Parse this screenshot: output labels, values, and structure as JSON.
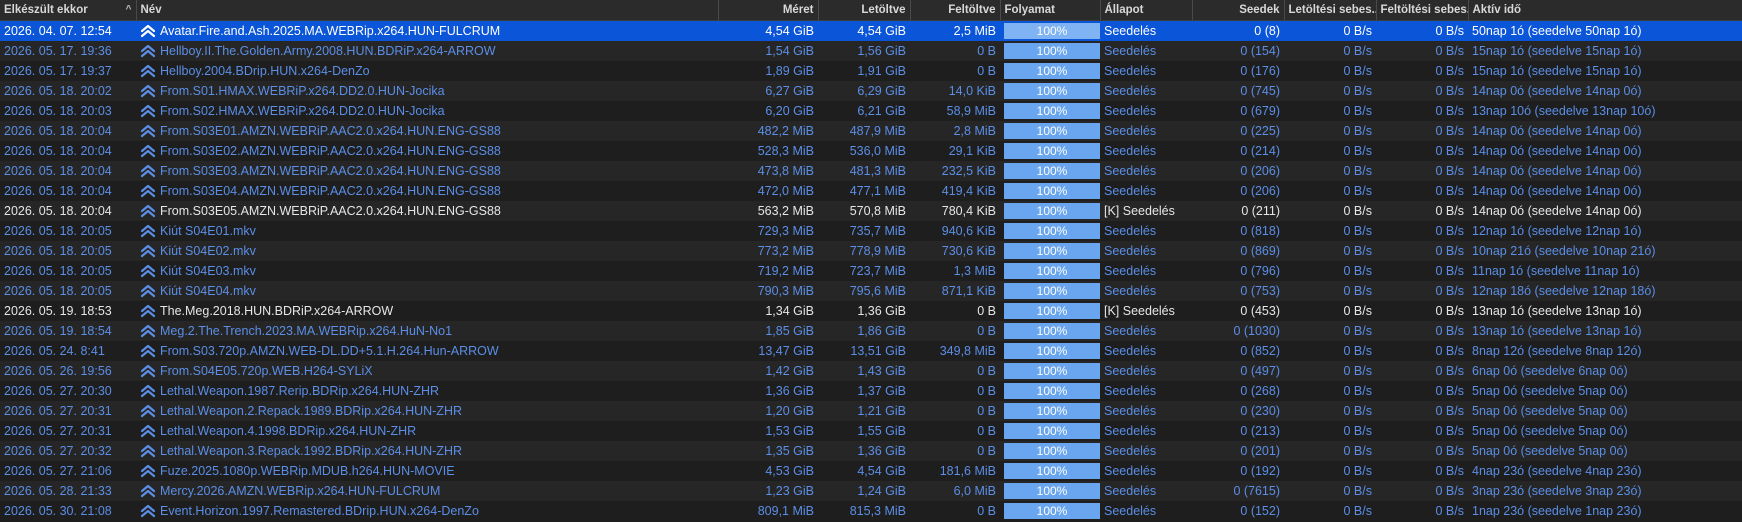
{
  "columns": {
    "completed": "Elkészült ekkor",
    "sort_indicator": "^",
    "name": "Név",
    "size": "Méret",
    "downloaded": "Letöltve",
    "uploaded": "Feltöltve",
    "progress": "Folyamat",
    "state": "Állapot",
    "seeds": "Seedek",
    "dl_speed": "Letöltési sebes...",
    "ul_speed": "Feltöltési sebes...",
    "active_time": "Aktív idő"
  },
  "colors": {
    "selection": "#0a55d8",
    "link_text": "#5b8ee6",
    "active_text": "#e6e6e6",
    "progress_fill": "#6aa6ef"
  },
  "row_icon": "double-chevron-up-icon",
  "rows": [
    {
      "completed": "2026. 04. 07. 12:54",
      "name": "Avatar.Fire.and.Ash.2025.MA.WEBRip.x264.HUN-FULCRUM",
      "size": "4,54 GiB",
      "downloaded": "4,54 GiB",
      "uploaded": "2,5 MiB",
      "progress": "100%",
      "state": "Seedelés",
      "seeds": "0 (8)",
      "dl_speed": "0 B/s",
      "ul_speed": "0 B/s",
      "active_time": "50nap 1ó (seedelve 50nap 1ó)"
    },
    {
      "completed": "2026. 05. 17. 19:36",
      "name": "Hellboy.II.The.Golden.Army.2008.HUN.BDRiP.x264-ARROW",
      "size": "1,54 GiB",
      "downloaded": "1,56 GiB",
      "uploaded": "0 B",
      "progress": "100%",
      "state": "Seedelés",
      "seeds": "0 (154)",
      "dl_speed": "0 B/s",
      "ul_speed": "0 B/s",
      "active_time": "15nap 1ó (seedelve 15nap 1ó)"
    },
    {
      "completed": "2026. 05. 17. 19:37",
      "name": "Hellboy.2004.BDrip.HUN.x264-DenZo",
      "size": "1,89 GiB",
      "downloaded": "1,91 GiB",
      "uploaded": "0 B",
      "progress": "100%",
      "state": "Seedelés",
      "seeds": "0 (176)",
      "dl_speed": "0 B/s",
      "ul_speed": "0 B/s",
      "active_time": "15nap 1ó (seedelve 15nap 1ó)"
    },
    {
      "completed": "2026. 05. 18. 20:02",
      "name": "From.S01.HMAX.WEBRiP.x264.DD2.0.HUN-Jocika",
      "size": "6,27 GiB",
      "downloaded": "6,29 GiB",
      "uploaded": "14,0 KiB",
      "progress": "100%",
      "state": "Seedelés",
      "seeds": "0 (745)",
      "dl_speed": "0 B/s",
      "ul_speed": "0 B/s",
      "active_time": "14nap 0ó (seedelve 14nap 0ó)"
    },
    {
      "completed": "2026. 05. 18. 20:03",
      "name": "From.S02.HMAX.WEBRiP.x264.DD2.0.HUN-Jocika",
      "size": "6,20 GiB",
      "downloaded": "6,21 GiB",
      "uploaded": "58,9 MiB",
      "progress": "100%",
      "state": "Seedelés",
      "seeds": "0 (679)",
      "dl_speed": "0 B/s",
      "ul_speed": "0 B/s",
      "active_time": "13nap 10ó (seedelve 13nap 10ó)"
    },
    {
      "completed": "2026. 05. 18. 20:04",
      "name": "From.S03E01.AMZN.WEBRiP.AAC2.0.x264.HUN.ENG-GS88",
      "size": "482,2 MiB",
      "downloaded": "487,9 MiB",
      "uploaded": "2,8 MiB",
      "progress": "100%",
      "state": "Seedelés",
      "seeds": "0 (225)",
      "dl_speed": "0 B/s",
      "ul_speed": "0 B/s",
      "active_time": "14nap 0ó (seedelve 14nap 0ó)"
    },
    {
      "completed": "2026. 05. 18. 20:04",
      "name": "From.S03E02.AMZN.WEBRiP.AAC2.0.x264.HUN.ENG-GS88",
      "size": "528,3 MiB",
      "downloaded": "536,0 MiB",
      "uploaded": "29,1 KiB",
      "progress": "100%",
      "state": "Seedelés",
      "seeds": "0 (214)",
      "dl_speed": "0 B/s",
      "ul_speed": "0 B/s",
      "active_time": "14nap 0ó (seedelve 14nap 0ó)"
    },
    {
      "completed": "2026. 05. 18. 20:04",
      "name": "From.S03E03.AMZN.WEBRiP.AAC2.0.x264.HUN.ENG-GS88",
      "size": "473,8 MiB",
      "downloaded": "481,3 MiB",
      "uploaded": "232,5 KiB",
      "progress": "100%",
      "state": "Seedelés",
      "seeds": "0 (206)",
      "dl_speed": "0 B/s",
      "ul_speed": "0 B/s",
      "active_time": "14nap 0ó (seedelve 14nap 0ó)"
    },
    {
      "completed": "2026. 05. 18. 20:04",
      "name": "From.S03E04.AMZN.WEBRiP.AAC2.0.x264.HUN.ENG-GS88",
      "size": "472,0 MiB",
      "downloaded": "477,1 MiB",
      "uploaded": "419,4 KiB",
      "progress": "100%",
      "state": "Seedelés",
      "seeds": "0 (206)",
      "dl_speed": "0 B/s",
      "ul_speed": "0 B/s",
      "active_time": "14nap 0ó (seedelve 14nap 0ó)"
    },
    {
      "completed": "2026. 05. 18. 20:04",
      "name": "From.S03E05.AMZN.WEBRiP.AAC2.0.x264.HUN.ENG-GS88",
      "size": "563,2 MiB",
      "downloaded": "570,8 MiB",
      "uploaded": "780,4 KiB",
      "progress": "100%",
      "state": "[K] Seedelés",
      "seeds": "0 (211)",
      "dl_speed": "0 B/s",
      "ul_speed": "0 B/s",
      "active_time": "14nap 0ó (seedelve 14nap 0ó)",
      "active": true
    },
    {
      "completed": "2026. 05. 18. 20:05",
      "name": "Kiút S04E01.mkv",
      "size": "729,3 MiB",
      "downloaded": "735,7 MiB",
      "uploaded": "940,6 KiB",
      "progress": "100%",
      "state": "Seedelés",
      "seeds": "0 (818)",
      "dl_speed": "0 B/s",
      "ul_speed": "0 B/s",
      "active_time": "12nap 1ó (seedelve 12nap 1ó)"
    },
    {
      "completed": "2026. 05. 18. 20:05",
      "name": "Kiút S04E02.mkv",
      "size": "773,2 MiB",
      "downloaded": "778,9 MiB",
      "uploaded": "730,6 KiB",
      "progress": "100%",
      "state": "Seedelés",
      "seeds": "0 (869)",
      "dl_speed": "0 B/s",
      "ul_speed": "0 B/s",
      "active_time": "10nap 21ó (seedelve 10nap 21ó)"
    },
    {
      "completed": "2026. 05. 18. 20:05",
      "name": "Kiút S04E03.mkv",
      "size": "719,2 MiB",
      "downloaded": "723,7 MiB",
      "uploaded": "1,3 MiB",
      "progress": "100%",
      "state": "Seedelés",
      "seeds": "0 (796)",
      "dl_speed": "0 B/s",
      "ul_speed": "0 B/s",
      "active_time": "11nap 1ó (seedelve 11nap 1ó)"
    },
    {
      "completed": "2026. 05. 18. 20:05",
      "name": "Kiút S04E04.mkv",
      "size": "790,3 MiB",
      "downloaded": "795,6 MiB",
      "uploaded": "871,1 KiB",
      "progress": "100%",
      "state": "Seedelés",
      "seeds": "0 (753)",
      "dl_speed": "0 B/s",
      "ul_speed": "0 B/s",
      "active_time": "12nap 18ó (seedelve 12nap 18ó)"
    },
    {
      "completed": "2026. 05. 19. 18:53",
      "name": "The.Meg.2018.HUN.BDRiP.x264-ARROW",
      "size": "1,34 GiB",
      "downloaded": "1,36 GiB",
      "uploaded": "0 B",
      "progress": "100%",
      "state": "[K] Seedelés",
      "seeds": "0 (453)",
      "dl_speed": "0 B/s",
      "ul_speed": "0 B/s",
      "active_time": "13nap 1ó (seedelve 13nap 1ó)",
      "active": true
    },
    {
      "completed": "2026. 05. 19. 18:54",
      "name": "Meg.2.The.Trench.2023.MA.WEBRip.x264.HuN-No1",
      "size": "1,85 GiB",
      "downloaded": "1,86 GiB",
      "uploaded": "0 B",
      "progress": "100%",
      "state": "Seedelés",
      "seeds": "0 (1030)",
      "dl_speed": "0 B/s",
      "ul_speed": "0 B/s",
      "active_time": "13nap 1ó (seedelve 13nap 1ó)"
    },
    {
      "completed": "2026. 05. 24. 8:41",
      "name": "From.S03.720p.AMZN.WEB-DL.DD+5.1.H.264.Hun-ARROW",
      "size": "13,47 GiB",
      "downloaded": "13,51 GiB",
      "uploaded": "349,8 MiB",
      "progress": "100%",
      "state": "Seedelés",
      "seeds": "0 (852)",
      "dl_speed": "0 B/s",
      "ul_speed": "0 B/s",
      "active_time": "8nap 12ó (seedelve 8nap 12ó)"
    },
    {
      "completed": "2026. 05. 26. 19:56",
      "name": "From.S04E05.720p.WEB.H264-SYLiX",
      "size": "1,42 GiB",
      "downloaded": "1,43 GiB",
      "uploaded": "0 B",
      "progress": "100%",
      "state": "Seedelés",
      "seeds": "0 (497)",
      "dl_speed": "0 B/s",
      "ul_speed": "0 B/s",
      "active_time": "6nap 0ó (seedelve 6nap 0ó)"
    },
    {
      "completed": "2026. 05. 27. 20:30",
      "name": "Lethal.Weapon.1987.Rerip.BDRip.x264.HUN-ZHR",
      "size": "1,36 GiB",
      "downloaded": "1,37 GiB",
      "uploaded": "0 B",
      "progress": "100%",
      "state": "Seedelés",
      "seeds": "0 (268)",
      "dl_speed": "0 B/s",
      "ul_speed": "0 B/s",
      "active_time": "5nap 0ó (seedelve 5nap 0ó)"
    },
    {
      "completed": "2026. 05. 27. 20:31",
      "name": "Lethal.Weapon.2.Repack.1989.BDRip.x264.HUN-ZHR",
      "size": "1,20 GiB",
      "downloaded": "1,21 GiB",
      "uploaded": "0 B",
      "progress": "100%",
      "state": "Seedelés",
      "seeds": "0 (230)",
      "dl_speed": "0 B/s",
      "ul_speed": "0 B/s",
      "active_time": "5nap 0ó (seedelve 5nap 0ó)"
    },
    {
      "completed": "2026. 05. 27. 20:31",
      "name": "Lethal.Weapon.4.1998.BDRip.x264.HUN-ZHR",
      "size": "1,53 GiB",
      "downloaded": "1,55 GiB",
      "uploaded": "0 B",
      "progress": "100%",
      "state": "Seedelés",
      "seeds": "0 (213)",
      "dl_speed": "0 B/s",
      "ul_speed": "0 B/s",
      "active_time": "5nap 0ó (seedelve 5nap 0ó)"
    },
    {
      "completed": "2026. 05. 27. 20:32",
      "name": "Lethal.Weapon.3.Repack.1992.BDRip.x264.HUN-ZHR",
      "size": "1,35 GiB",
      "downloaded": "1,36 GiB",
      "uploaded": "0 B",
      "progress": "100%",
      "state": "Seedelés",
      "seeds": "0 (201)",
      "dl_speed": "0 B/s",
      "ul_speed": "0 B/s",
      "active_time": "5nap 0ó (seedelve 5nap 0ó)"
    },
    {
      "completed": "2026. 05. 27. 21:06",
      "name": "Fuze.2025.1080p.WEBRip.MDUB.h264.HUN-MOVIE",
      "size": "4,53 GiB",
      "downloaded": "4,54 GiB",
      "uploaded": "181,6 MiB",
      "progress": "100%",
      "state": "Seedelés",
      "seeds": "0 (192)",
      "dl_speed": "0 B/s",
      "ul_speed": "0 B/s",
      "active_time": "4nap 23ó (seedelve 4nap 23ó)"
    },
    {
      "completed": "2026. 05. 28. 21:33",
      "name": "Mercy.2026.AMZN.WEBRip.x264.HUN-FULCRUM",
      "size": "1,23 GiB",
      "downloaded": "1,24 GiB",
      "uploaded": "6,0 MiB",
      "progress": "100%",
      "state": "Seedelés",
      "seeds": "0 (7615)",
      "dl_speed": "0 B/s",
      "ul_speed": "0 B/s",
      "active_time": "3nap 23ó (seedelve 3nap 23ó)"
    },
    {
      "completed": "2026. 05. 30. 21:08",
      "name": "Event.Horizon.1997.Remastered.BDrip.HUN.x264-DenZo",
      "size": "809,1 MiB",
      "downloaded": "815,3 MiB",
      "uploaded": "0 B",
      "progress": "100%",
      "state": "Seedelés",
      "seeds": "0 (152)",
      "dl_speed": "0 B/s",
      "ul_speed": "0 B/s",
      "active_time": "1nap 23ó (seedelve 1nap 23ó)"
    }
  ]
}
